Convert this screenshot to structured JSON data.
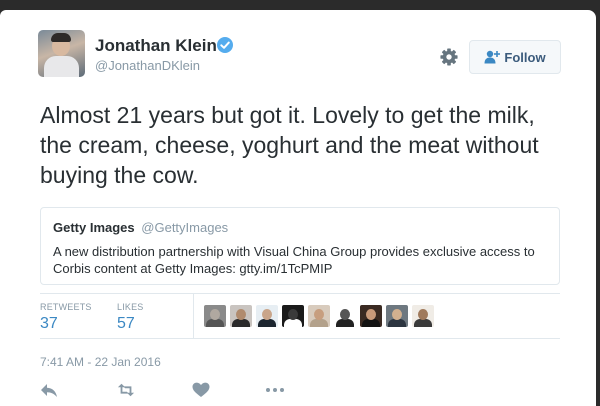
{
  "author": {
    "name": "Jonathan Klein",
    "handle": "@JonathanDKlein",
    "verified": true
  },
  "follow_button": {
    "label": "Follow",
    "icon": "add-user-icon"
  },
  "settings_icon": "gear-icon",
  "tweet": {
    "text": "Almost 21 years but got it. Lovely to get the milk, the cream, cheese, yoghurt and the meat without buying the cow."
  },
  "quoted_tweet": {
    "name": "Getty Images",
    "handle": "@GettyImages",
    "text": "A new distribution partnership with Visual China Group provides exclusive access to Corbis content at Getty Images: gtty.im/1TcPMIP"
  },
  "stats": {
    "retweets_label": "RETWEETS",
    "retweets": "37",
    "likes_label": "LIKES",
    "likes": "57"
  },
  "likers": [
    {
      "bg": "#8a8a8a",
      "face": "#b0a8a0",
      "body": "#555555"
    },
    {
      "bg": "#c9c4c0",
      "face": "#b08b6e",
      "body": "#2a2a2a"
    },
    {
      "bg": "#e7eef3",
      "face": "#c9a58a",
      "body": "#1d2630"
    },
    {
      "bg": "#1a1a1a",
      "face": "#3a3a3a",
      "body": "#ffffff"
    },
    {
      "bg": "#d8cbbd",
      "face": "#c79e7f",
      "body": "#b3a18b"
    },
    {
      "bg": "#ffffff",
      "face": "#555555",
      "body": "#222222"
    },
    {
      "bg": "#3a2a22",
      "face": "#c99a7a",
      "body": "#121212"
    },
    {
      "bg": "#6e7880",
      "face": "#d2b08f",
      "body": "#2c3540"
    },
    {
      "bg": "#f0ece6",
      "face": "#a07a5c",
      "body": "#3a3a3a"
    }
  ],
  "timestamp": "7:41 AM - 22 Jan 2016",
  "actions": [
    "reply-icon",
    "retweet-icon",
    "like-icon",
    "more-icon"
  ],
  "colors": {
    "accent": "#3b88c3",
    "verified": "#55acee",
    "text": "#292f33",
    "muted": "#8899a6",
    "border": "#e1e8ed"
  }
}
